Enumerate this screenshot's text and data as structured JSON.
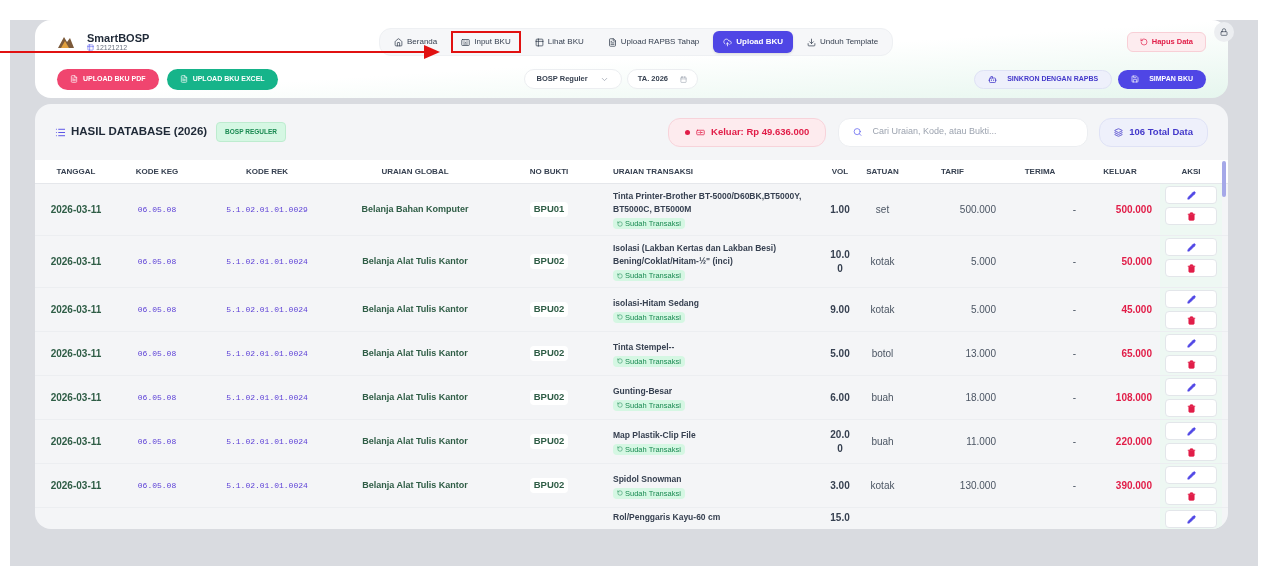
{
  "app": {
    "name": "SmartBOSP",
    "code": "12121212"
  },
  "nav": [
    {
      "label": "Beranda",
      "selected": false,
      "highlighted": false
    },
    {
      "label": "Input BKU",
      "selected": false,
      "highlighted": true
    },
    {
      "label": "Lihat BKU",
      "selected": false,
      "highlighted": false
    },
    {
      "label": "Upload RAPBS Tahap",
      "selected": false,
      "highlighted": false
    },
    {
      "label": "Upload BKU",
      "selected": true,
      "highlighted": false
    },
    {
      "label": "Unduh Template",
      "selected": false,
      "highlighted": false
    }
  ],
  "reset_button": "Hapus Data",
  "upload_buttons": [
    {
      "label": "UPLOAD BKU PDF",
      "color": "#f0456f"
    },
    {
      "label": "UPLOAD BKU EXCEL",
      "color": "#16b48a"
    }
  ],
  "source_select": "BOSP Reguler",
  "year_field": "TA. 2026",
  "sync_button": "SINKRON DENGAN RAPBS",
  "save_button": "SIMPAN BKU",
  "panel": {
    "title": "HASIL DATABASE (2026)",
    "badge": "BOSP REGULER",
    "total_out": "Keluar: Rp 49.636.000",
    "search_placeholder": "Cari Uraian, Kode, atau Bukti...",
    "total_count": "106 Total Data"
  },
  "table": {
    "columns": [
      "TANGGAL",
      "KODE KEG",
      "KODE REK",
      "URAIAN GLOBAL",
      "NO BUKTI",
      "URAIAN TRANSAKSI",
      "VOL",
      "SATUAN",
      "TARIF",
      "TERIMA",
      "KELUAR",
      "AKSI"
    ],
    "rows": [
      {
        "tanggal": "2026-03-11",
        "kode_keg": "06.05.08",
        "kode_rek": "5.1.02.01.01.0029",
        "uraian_global": "Belanja Bahan Komputer",
        "no_bukti": "BPU01",
        "uraian_transaksi": "Tinta Printer-Brother BT-5000/D60BK,BT5000Y, BT5000C, BT5000M",
        "status": "Sudah Transaksi",
        "vol": "1.00",
        "satuan": "set",
        "tarif": "500.000",
        "terima": "-",
        "keluar": "500.000",
        "actions": [
          {
            "kind": "edit"
          },
          {
            "kind": "delete"
          }
        ]
      },
      {
        "tanggal": "2026-03-11",
        "kode_keg": "06.05.08",
        "kode_rek": "5.1.02.01.01.0024",
        "uraian_global": "Belanja Alat Tulis Kantor",
        "no_bukti": "BPU02",
        "uraian_transaksi": "Isolasi (Lakban Kertas dan Lakban Besi) Bening/Coklat/Hitam-½\" (inci)",
        "status": "Sudah Transaksi",
        "vol": "10.00",
        "satuan": "kotak",
        "tarif": "5.000",
        "terima": "-",
        "keluar": "50.000",
        "actions": [
          {
            "kind": "edit"
          },
          {
            "kind": "delete"
          }
        ]
      },
      {
        "tanggal": "2026-03-11",
        "kode_keg": "06.05.08",
        "kode_rek": "5.1.02.01.01.0024",
        "uraian_global": "Belanja Alat Tulis Kantor",
        "no_bukti": "BPU02",
        "uraian_transaksi": "isolasi-Hitam Sedang",
        "status": "Sudah Transaksi",
        "vol": "9.00",
        "satuan": "kotak",
        "tarif": "5.000",
        "terima": "-",
        "keluar": "45.000",
        "actions": [
          {
            "kind": "edit"
          },
          {
            "kind": "delete"
          }
        ]
      },
      {
        "tanggal": "2026-03-11",
        "kode_keg": "06.05.08",
        "kode_rek": "5.1.02.01.01.0024",
        "uraian_global": "Belanja Alat Tulis Kantor",
        "no_bukti": "BPU02",
        "uraian_transaksi": "Tinta Stempel--",
        "status": "Sudah Transaksi",
        "vol": "5.00",
        "satuan": "botol",
        "tarif": "13.000",
        "terima": "-",
        "keluar": "65.000",
        "actions": [
          {
            "kind": "edit"
          },
          {
            "kind": "delete"
          }
        ]
      },
      {
        "tanggal": "2026-03-11",
        "kode_keg": "06.05.08",
        "kode_rek": "5.1.02.01.01.0024",
        "uraian_global": "Belanja Alat Tulis Kantor",
        "no_bukti": "BPU02",
        "uraian_transaksi": "Gunting-Besar",
        "status": "Sudah Transaksi",
        "vol": "6.00",
        "satuan": "buah",
        "tarif": "18.000",
        "terima": "-",
        "keluar": "108.000",
        "actions": [
          {
            "kind": "edit"
          },
          {
            "kind": "delete"
          }
        ]
      },
      {
        "tanggal": "2026-03-11",
        "kode_keg": "06.05.08",
        "kode_rek": "5.1.02.01.01.0024",
        "uraian_global": "Belanja Alat Tulis Kantor",
        "no_bukti": "BPU02",
        "uraian_transaksi": "Map Plastik-Clip File",
        "status": "Sudah Transaksi",
        "vol": "20.00",
        "satuan": "buah",
        "tarif": "11.000",
        "terima": "-",
        "keluar": "220.000",
        "actions": [
          {
            "kind": "edit"
          },
          {
            "kind": "delete"
          }
        ]
      },
      {
        "tanggal": "2026-03-11",
        "kode_keg": "06.05.08",
        "kode_rek": "5.1.02.01.01.0024",
        "uraian_global": "Belanja Alat Tulis Kantor",
        "no_bukti": "BPU02",
        "uraian_transaksi": "Spidol Snowman",
        "status": "Sudah Transaksi",
        "vol": "3.00",
        "satuan": "kotak",
        "tarif": "130.000",
        "terima": "-",
        "keluar": "390.000",
        "actions": [
          {
            "kind": "edit"
          },
          {
            "kind": "delete"
          }
        ]
      },
      {
        "uraian_transaksi": "Rol/Penggaris Kayu-60 cm",
        "vol": "15.0",
        "actions": [
          {
            "kind": "edit"
          }
        ]
      }
    ]
  }
}
